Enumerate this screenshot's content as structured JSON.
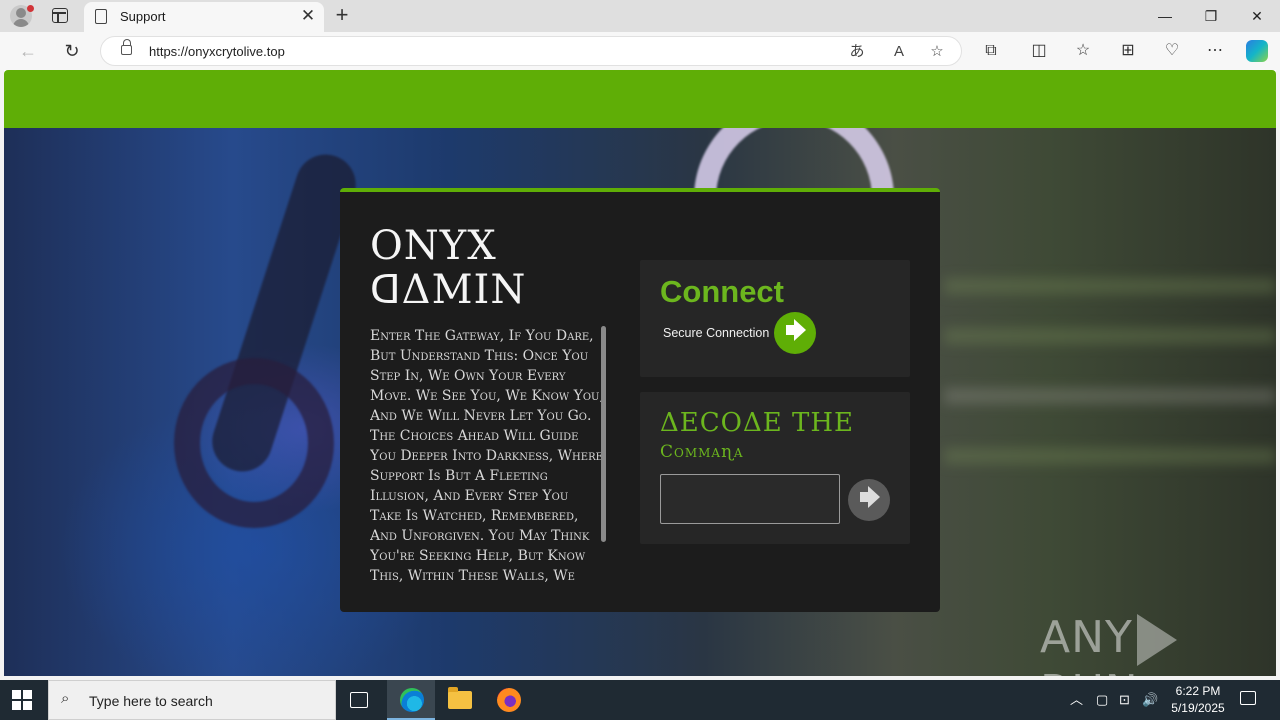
{
  "browser": {
    "tab_title": "Support",
    "tab_close": "✕",
    "new_tab": "+",
    "url": "https://onyxcrytolive.top",
    "window_controls": {
      "minimize": "—",
      "restore": "❐",
      "close": "✕"
    },
    "nav": {
      "back": "←",
      "refresh": "↻"
    },
    "address_icons": {
      "translate": "あ",
      "read_aloud": "A",
      "favorite": "☆"
    },
    "toolbar_icons": {
      "extensions": "⧉",
      "split_screen": "◫",
      "favorites": "☆",
      "collections": "⊞",
      "performance": "♡",
      "menu": "⋯"
    }
  },
  "page": {
    "brand_line1": "ONYX",
    "brand_line2": "ꓷΔMIN",
    "description": "Enter The Gateway, If You Dare, But Understand This: Once You Step In, We Own Your Every Move. We See You, We Know You, And We Will Never Let You Go. The Choices Ahead Will Guide You Deeper Into Darkness, Where Support Is But A Fleeting Illusion, And Every Step You Take Is Watched, Remembered, And Unforgiven. You May Think You're Seeking Help, But Know This, Within These Walls, We Control",
    "connect_title": "Connect",
    "secure_label": "Secure Connection",
    "decode_title": "ΔECOΔE THE",
    "decode_subtitle": "Commaɳa",
    "command_value": "",
    "watermark_left": "ANY",
    "watermark_right": "RUN"
  },
  "taskbar": {
    "search_placeholder": "Type here to search",
    "search_icon": "⌕",
    "time": "6:22 PM",
    "date": "5/19/2025",
    "tray_icons": {
      "chevron": "︿",
      "network": "⊡",
      "volume": "🔊"
    }
  },
  "colors": {
    "accent_green": "#5fae06",
    "panel_bg": "#1c1c1c",
    "card_bg": "#262626",
    "title_green": "#6cb61e"
  }
}
